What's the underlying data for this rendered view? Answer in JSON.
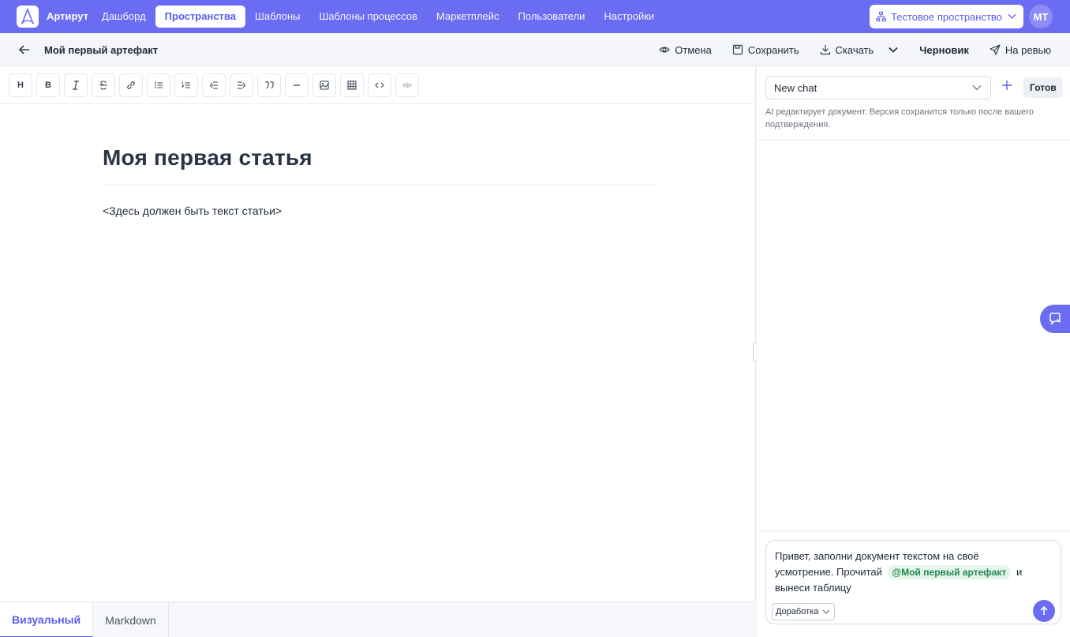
{
  "topnav": {
    "brand": "Артирут",
    "items": [
      {
        "label": "Дашборд",
        "active": false
      },
      {
        "label": "Пространства",
        "active": true
      },
      {
        "label": "Шаблоны",
        "active": false
      },
      {
        "label": "Шаблоны процессов",
        "active": false
      },
      {
        "label": "Маркетплейс",
        "active": false
      },
      {
        "label": "Пользователи",
        "active": false
      },
      {
        "label": "Настройки",
        "active": false
      }
    ],
    "space_select": "Тестовое пространство",
    "avatar_initials": "МТ",
    "accent": "#6a6cf2"
  },
  "subheader": {
    "title": "Мой первый артефакт",
    "cancel": "Отмена",
    "save": "Сохранить",
    "download": "Скачать",
    "status": "Черновик",
    "review": "На ревью"
  },
  "editor": {
    "heading": "Моя первая статья",
    "paragraph": "<Здесь должен быть текст статьи>",
    "toolbar_heading_label": "H",
    "toolbar_bold_label": "B",
    "tabs": [
      {
        "label": "Визуальный",
        "active": true
      },
      {
        "label": "Markdown",
        "active": false
      }
    ]
  },
  "chat": {
    "select_value": "New chat",
    "done_label": "Готов",
    "note": "AI редактирует документ. Версия сохранится только после вашего подтверждения.",
    "composer": {
      "text_before": "Привет, заполни документ текстом на своё усмотрение. Прочитай",
      "mention": "@Мой первый артефакт",
      "text_after": "и вынеси таблицу"
    },
    "mode": "Доработка"
  }
}
